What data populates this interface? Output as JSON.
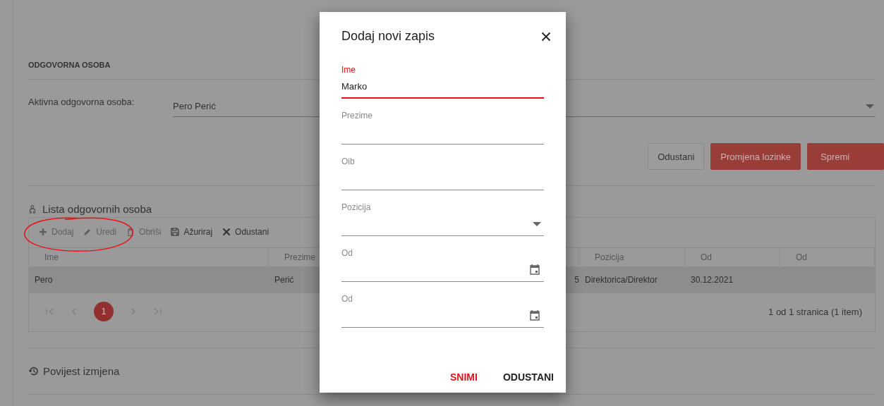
{
  "section_title": "ODGOVORNA OSOBA",
  "active_person": {
    "label": "Aktivna odgovorna osoba:",
    "value": "Pero Perić"
  },
  "buttons": [
    {
      "label": "Odustani",
      "kind": "outline"
    },
    {
      "label": "Promjena lozinke",
      "kind": "primary"
    },
    {
      "label": "Spremi",
      "kind": "primary"
    }
  ],
  "list": {
    "title": "Lista odgovornih osoba",
    "toolbar": [
      {
        "label": "Dodaj",
        "disabled": true
      },
      {
        "label": "Uredi",
        "disabled": true
      },
      {
        "label": "Obriši",
        "disabled": true
      },
      {
        "label": "Ažuriraj",
        "disabled": false
      },
      {
        "label": "Odustani",
        "disabled": false
      }
    ],
    "columns": [
      "Ime",
      "Prezime",
      null,
      "Pozicija",
      "Od",
      "Od"
    ],
    "rows": [
      {
        "cells": [
          "Pero",
          "Perić",
          "5",
          "Direktorica/Direktor",
          "30.12.2021",
          null
        ],
        "selected": true
      }
    ],
    "pages": [
      {
        "label": "1",
        "selected": true
      }
    ],
    "summary": "1 od 1 stranica (1 item)"
  },
  "history": {
    "title": "Povijest izmjena"
  },
  "dialog": {
    "title": "Dodaj novi zapis",
    "fields": [
      {
        "label": "Ime",
        "value": "Marko",
        "kind": "text",
        "focused": true
      },
      {
        "label": "Prezime",
        "kind": "text",
        "focused": false
      },
      {
        "label": "Oib",
        "kind": "text",
        "focused": false
      },
      {
        "label": "Pozicija",
        "kind": "select",
        "focused": false
      },
      {
        "label": "Od",
        "kind": "date",
        "focused": false
      },
      {
        "label": "Od",
        "kind": "date",
        "focused": false
      }
    ],
    "actions": [
      {
        "label": "SNIMI",
        "kind": "primary"
      },
      {
        "label": "ODUSTANI",
        "kind": "secondary"
      }
    ]
  }
}
